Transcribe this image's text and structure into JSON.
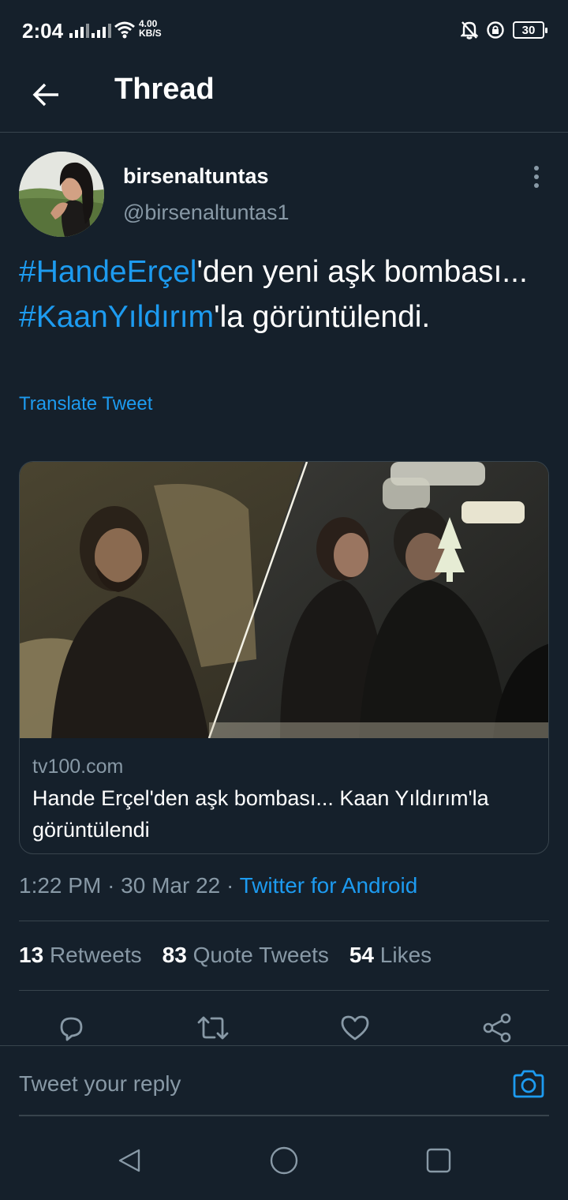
{
  "status_bar": {
    "time": "2:04",
    "net_speed_value": "4.00",
    "net_speed_unit": "KB/S",
    "battery": "30"
  },
  "header": {
    "title": "Thread"
  },
  "tweet": {
    "author_name": "birsenaltuntas",
    "author_handle": "@birsenaltuntas1",
    "text_parts": {
      "hashtag1": "#HandeErçel",
      "text1": "'den yeni aşk bombası... ",
      "hashtag2": "#KaanYıldırım",
      "text2": "'la görüntülendi."
    },
    "translate_label": "Translate Tweet",
    "card": {
      "domain": "tv100.com",
      "title": "Hande Erçel'den aşk bombası... Kaan Yıldırım'la görüntülendi"
    },
    "time": "1:22 PM",
    "date": "30 Mar 22",
    "source": "Twitter for Android",
    "stats": {
      "retweets_count": "13",
      "retweets_label": "Retweets",
      "quotes_count": "83",
      "quotes_label": "Quote Tweets",
      "likes_count": "54",
      "likes_label": "Likes"
    }
  },
  "reply": {
    "placeholder": "Tweet your reply"
  },
  "icons": {
    "back": "arrow-left-icon",
    "more": "vertical-dots-icon",
    "reply": "comment-icon",
    "retweet": "retweet-icon",
    "like": "heart-icon",
    "share": "share-icon",
    "camera": "camera-icon"
  },
  "colors": {
    "background": "#15202b",
    "accent": "#1d9bf0",
    "secondary_text": "#8899a6",
    "divider": "#38444d"
  }
}
